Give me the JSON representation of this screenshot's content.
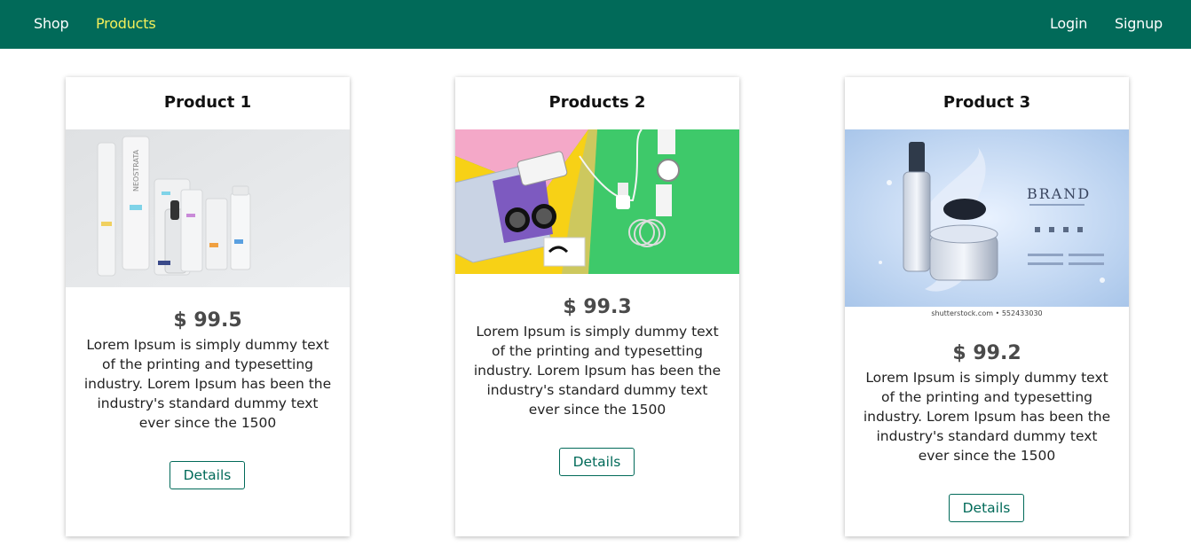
{
  "nav": {
    "left": [
      {
        "label": "Shop"
      },
      {
        "label": "Products"
      }
    ],
    "right": [
      {
        "label": "Login"
      },
      {
        "label": "Signup"
      }
    ],
    "accent": "#f5f05a",
    "background": "#016a59"
  },
  "products": [
    {
      "title": "Product 1",
      "price": "$ 99.5",
      "description": "Lorem Ipsum is simply dummy text of the printing and typesetting industry. Lorem Ipsum has been the industry's standard dummy text ever since the 1500",
      "button": "Details",
      "image_label": "NEOSTRATA"
    },
    {
      "title": "Products 2",
      "price": "$ 99.3",
      "description": "Lorem Ipsum is simply dummy text of the printing and typesetting industry. Lorem Ipsum has been the industry's standard dummy text ever since the 1500",
      "button": "Details"
    },
    {
      "title": "Product 3",
      "price": "$ 99.2",
      "description": "Lorem Ipsum is simply dummy text of the printing and typesetting industry. Lorem Ipsum has been the industry's standard dummy text ever since the 1500",
      "button": "Details",
      "image_label": "BRAND",
      "image_watermark": "shutterstock.com • 552433030"
    }
  ]
}
